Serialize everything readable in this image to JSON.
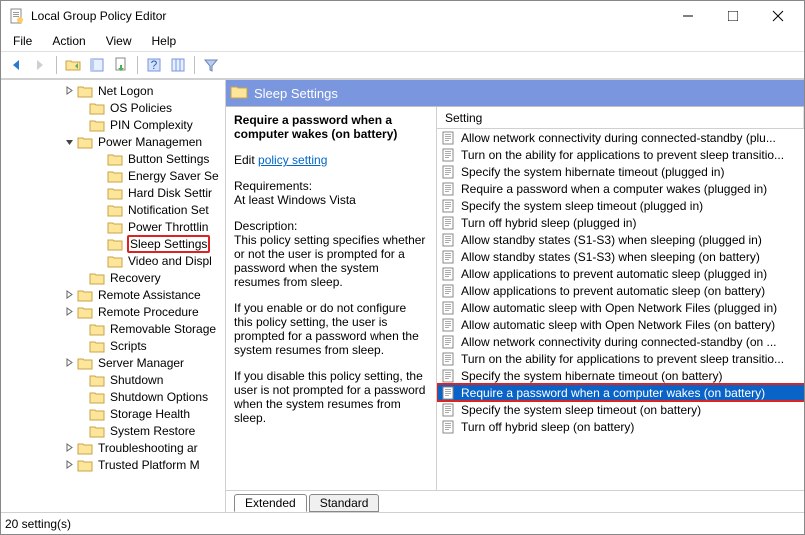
{
  "window": {
    "title": "Local Group Policy Editor"
  },
  "menubar": [
    "File",
    "Action",
    "View",
    "Help"
  ],
  "tree": {
    "items": [
      {
        "indent": 60,
        "expander": "collapsed",
        "label": "Net Logon"
      },
      {
        "indent": 72,
        "expander": "",
        "label": "OS Policies"
      },
      {
        "indent": 72,
        "expander": "",
        "label": "PIN Complexity"
      },
      {
        "indent": 60,
        "expander": "expanded",
        "label": "Power Managemen"
      },
      {
        "indent": 90,
        "expander": "",
        "label": "Button Settings"
      },
      {
        "indent": 90,
        "expander": "",
        "label": "Energy Saver Se"
      },
      {
        "indent": 90,
        "expander": "",
        "label": "Hard Disk Settir"
      },
      {
        "indent": 90,
        "expander": "",
        "label": "Notification Set"
      },
      {
        "indent": 90,
        "expander": "",
        "label": "Power Throttlin"
      },
      {
        "indent": 90,
        "expander": "",
        "label": "Sleep Settings",
        "highlighted": true
      },
      {
        "indent": 90,
        "expander": "",
        "label": "Video and Displ"
      },
      {
        "indent": 72,
        "expander": "",
        "label": "Recovery"
      },
      {
        "indent": 60,
        "expander": "collapsed",
        "label": "Remote Assistance"
      },
      {
        "indent": 60,
        "expander": "collapsed",
        "label": "Remote Procedure"
      },
      {
        "indent": 72,
        "expander": "",
        "label": "Removable Storage"
      },
      {
        "indent": 72,
        "expander": "",
        "label": "Scripts"
      },
      {
        "indent": 60,
        "expander": "collapsed",
        "label": "Server Manager"
      },
      {
        "indent": 72,
        "expander": "",
        "label": "Shutdown"
      },
      {
        "indent": 72,
        "expander": "",
        "label": "Shutdown Options"
      },
      {
        "indent": 72,
        "expander": "",
        "label": "Storage Health"
      },
      {
        "indent": 72,
        "expander": "",
        "label": "System Restore"
      },
      {
        "indent": 60,
        "expander": "collapsed",
        "label": "Troubleshooting ar"
      },
      {
        "indent": 60,
        "expander": "collapsed",
        "label": "Trusted Platform M"
      }
    ]
  },
  "pane": {
    "header": "Sleep Settings",
    "policy_title": "Require a password when a computer wakes (on battery)",
    "edit_label": "Edit",
    "policy_link": "policy setting",
    "requirements_label": "Requirements:",
    "requirements_text": "At least Windows Vista",
    "description_label": "Description:",
    "description_body": "This policy setting specifies whether or not the user is prompted for a password when the system resumes from sleep.",
    "enable_text": "If you enable or do not configure this policy setting, the user is prompted for a password when the system resumes from sleep.",
    "disable_text": "If you disable this policy setting, the user is not prompted for a password when the system resumes from sleep."
  },
  "setting_header": "Setting",
  "settings": [
    {
      "label": "Allow network connectivity during connected-standby (plu..."
    },
    {
      "label": "Turn on the ability for applications to prevent sleep transitio..."
    },
    {
      "label": "Specify the system hibernate timeout (plugged in)"
    },
    {
      "label": "Require a password when a computer wakes (plugged in)"
    },
    {
      "label": "Specify the system sleep timeout (plugged in)"
    },
    {
      "label": "Turn off hybrid sleep (plugged in)"
    },
    {
      "label": "Allow standby states (S1-S3) when sleeping (plugged in)"
    },
    {
      "label": "Allow standby states (S1-S3) when sleeping (on battery)"
    },
    {
      "label": "Allow applications to prevent automatic sleep (plugged in)"
    },
    {
      "label": "Allow applications to prevent automatic sleep (on battery)"
    },
    {
      "label": "Allow automatic sleep with Open Network Files (plugged in)"
    },
    {
      "label": "Allow automatic sleep with Open Network Files (on battery)"
    },
    {
      "label": "Allow network connectivity during connected-standby (on ..."
    },
    {
      "label": "Turn on the ability for applications to prevent sleep transitio..."
    },
    {
      "label": "Specify the system hibernate timeout (on battery)"
    },
    {
      "label": "Require a password when a computer wakes (on battery)",
      "selected": true
    },
    {
      "label": "Specify the system sleep timeout (on battery)"
    },
    {
      "label": "Turn off hybrid sleep (on battery)"
    }
  ],
  "tabs": {
    "extended": "Extended",
    "standard": "Standard"
  },
  "status": "20 setting(s)"
}
